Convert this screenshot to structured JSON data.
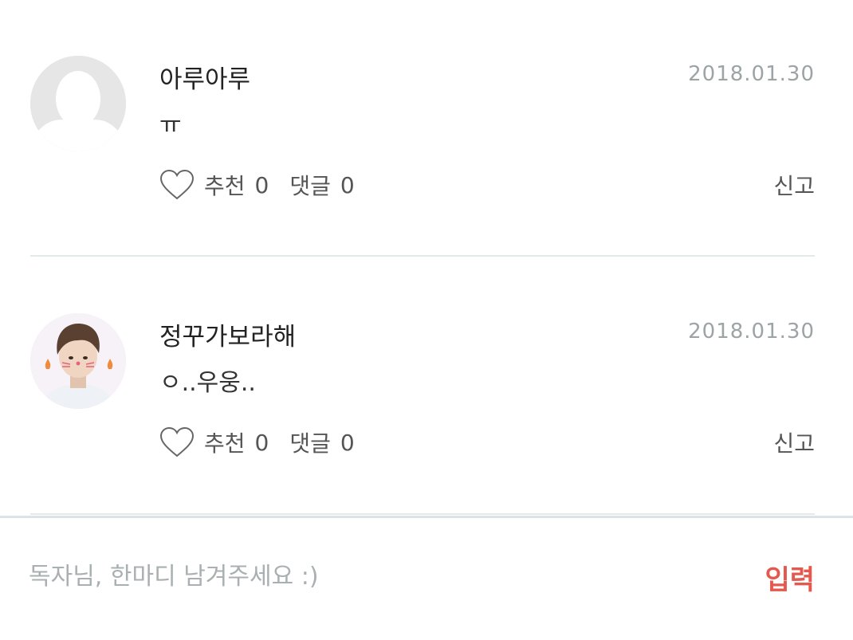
{
  "comments": [
    {
      "nickname": "아루아루",
      "date": "2018.01.30",
      "text": "ㅠ",
      "like_label": "추천",
      "like_count": "0",
      "reply_label": "댓글",
      "reply_count": "0",
      "report_label": "신고",
      "avatar": "default-user-icon"
    },
    {
      "nickname": "정꾸가보라해",
      "date": "2018.01.30",
      "text": "ㅇ..우웅..",
      "like_label": "추천",
      "like_count": "0",
      "reply_label": "댓글",
      "reply_count": "0",
      "report_label": "신고",
      "avatar": "profile-photo"
    }
  ],
  "input_bar": {
    "placeholder": "독자님, 한마디 남겨주세요 :)",
    "value": "",
    "submit_label": "입력"
  },
  "colors": {
    "accent": "#e4594e",
    "date": "#9da4a5",
    "divider": "#e3e8e9",
    "placeholder": "#a9b0b1"
  }
}
